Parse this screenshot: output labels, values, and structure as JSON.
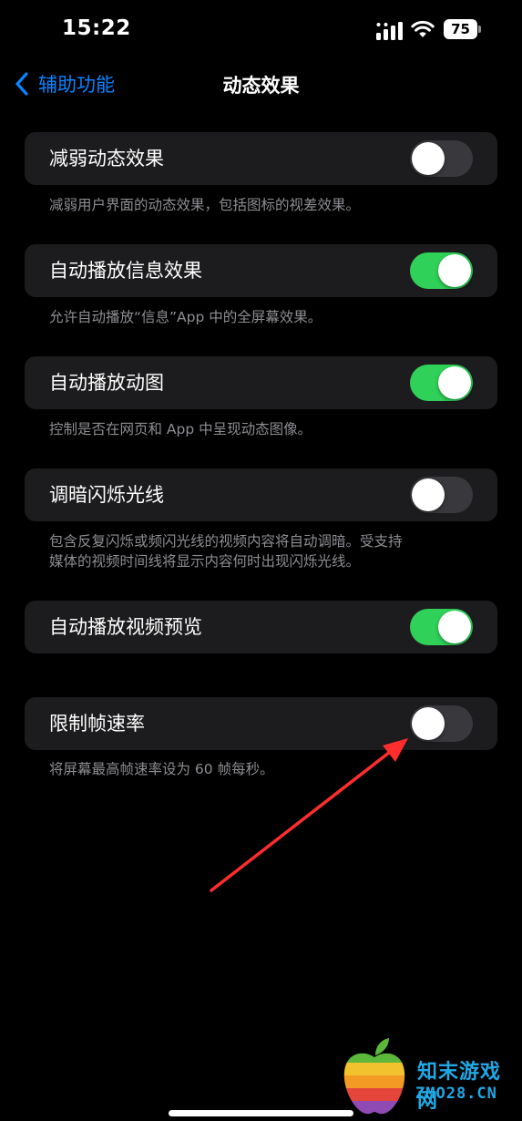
{
  "status_bar": {
    "time": "15:22",
    "battery": "75"
  },
  "nav": {
    "back_label": "辅助功能",
    "title": "动态效果"
  },
  "settings": [
    {
      "label": "减弱动态效果",
      "on": false,
      "footnote": [
        "减弱用户界面的动态效果，包括图标的视差效果。"
      ]
    },
    {
      "label": "自动播放信息效果",
      "on": true,
      "footnote": [
        "允许自动播放“信息”App 中的全屏幕效果。"
      ]
    },
    {
      "label": "自动播放动图",
      "on": true,
      "footnote": [
        "控制是否在网页和 App 中呈现动态图像。"
      ]
    },
    {
      "label": "调暗闪烁光线",
      "on": false,
      "footnote": [
        "包含反复闪烁或频闪光线的视频内容将自动调暗。受支持",
        "媒体的视频时间线将显示内容何时出现闪烁光线。"
      ]
    },
    {
      "label": "自动播放视频预览",
      "on": true,
      "footnote": []
    },
    {
      "label": "限制帧速率",
      "on": false,
      "footnote": [
        "将屏幕最高帧速率设为 60 帧每秒。"
      ]
    }
  ],
  "watermark": {
    "cn": "知末游戏网",
    "en": "ZMO28.CN"
  },
  "colors": {
    "accent": "#0a84ff",
    "toggle_on": "#30d158",
    "toggle_off": "#39393d",
    "arrow": "#ff2d2d"
  }
}
